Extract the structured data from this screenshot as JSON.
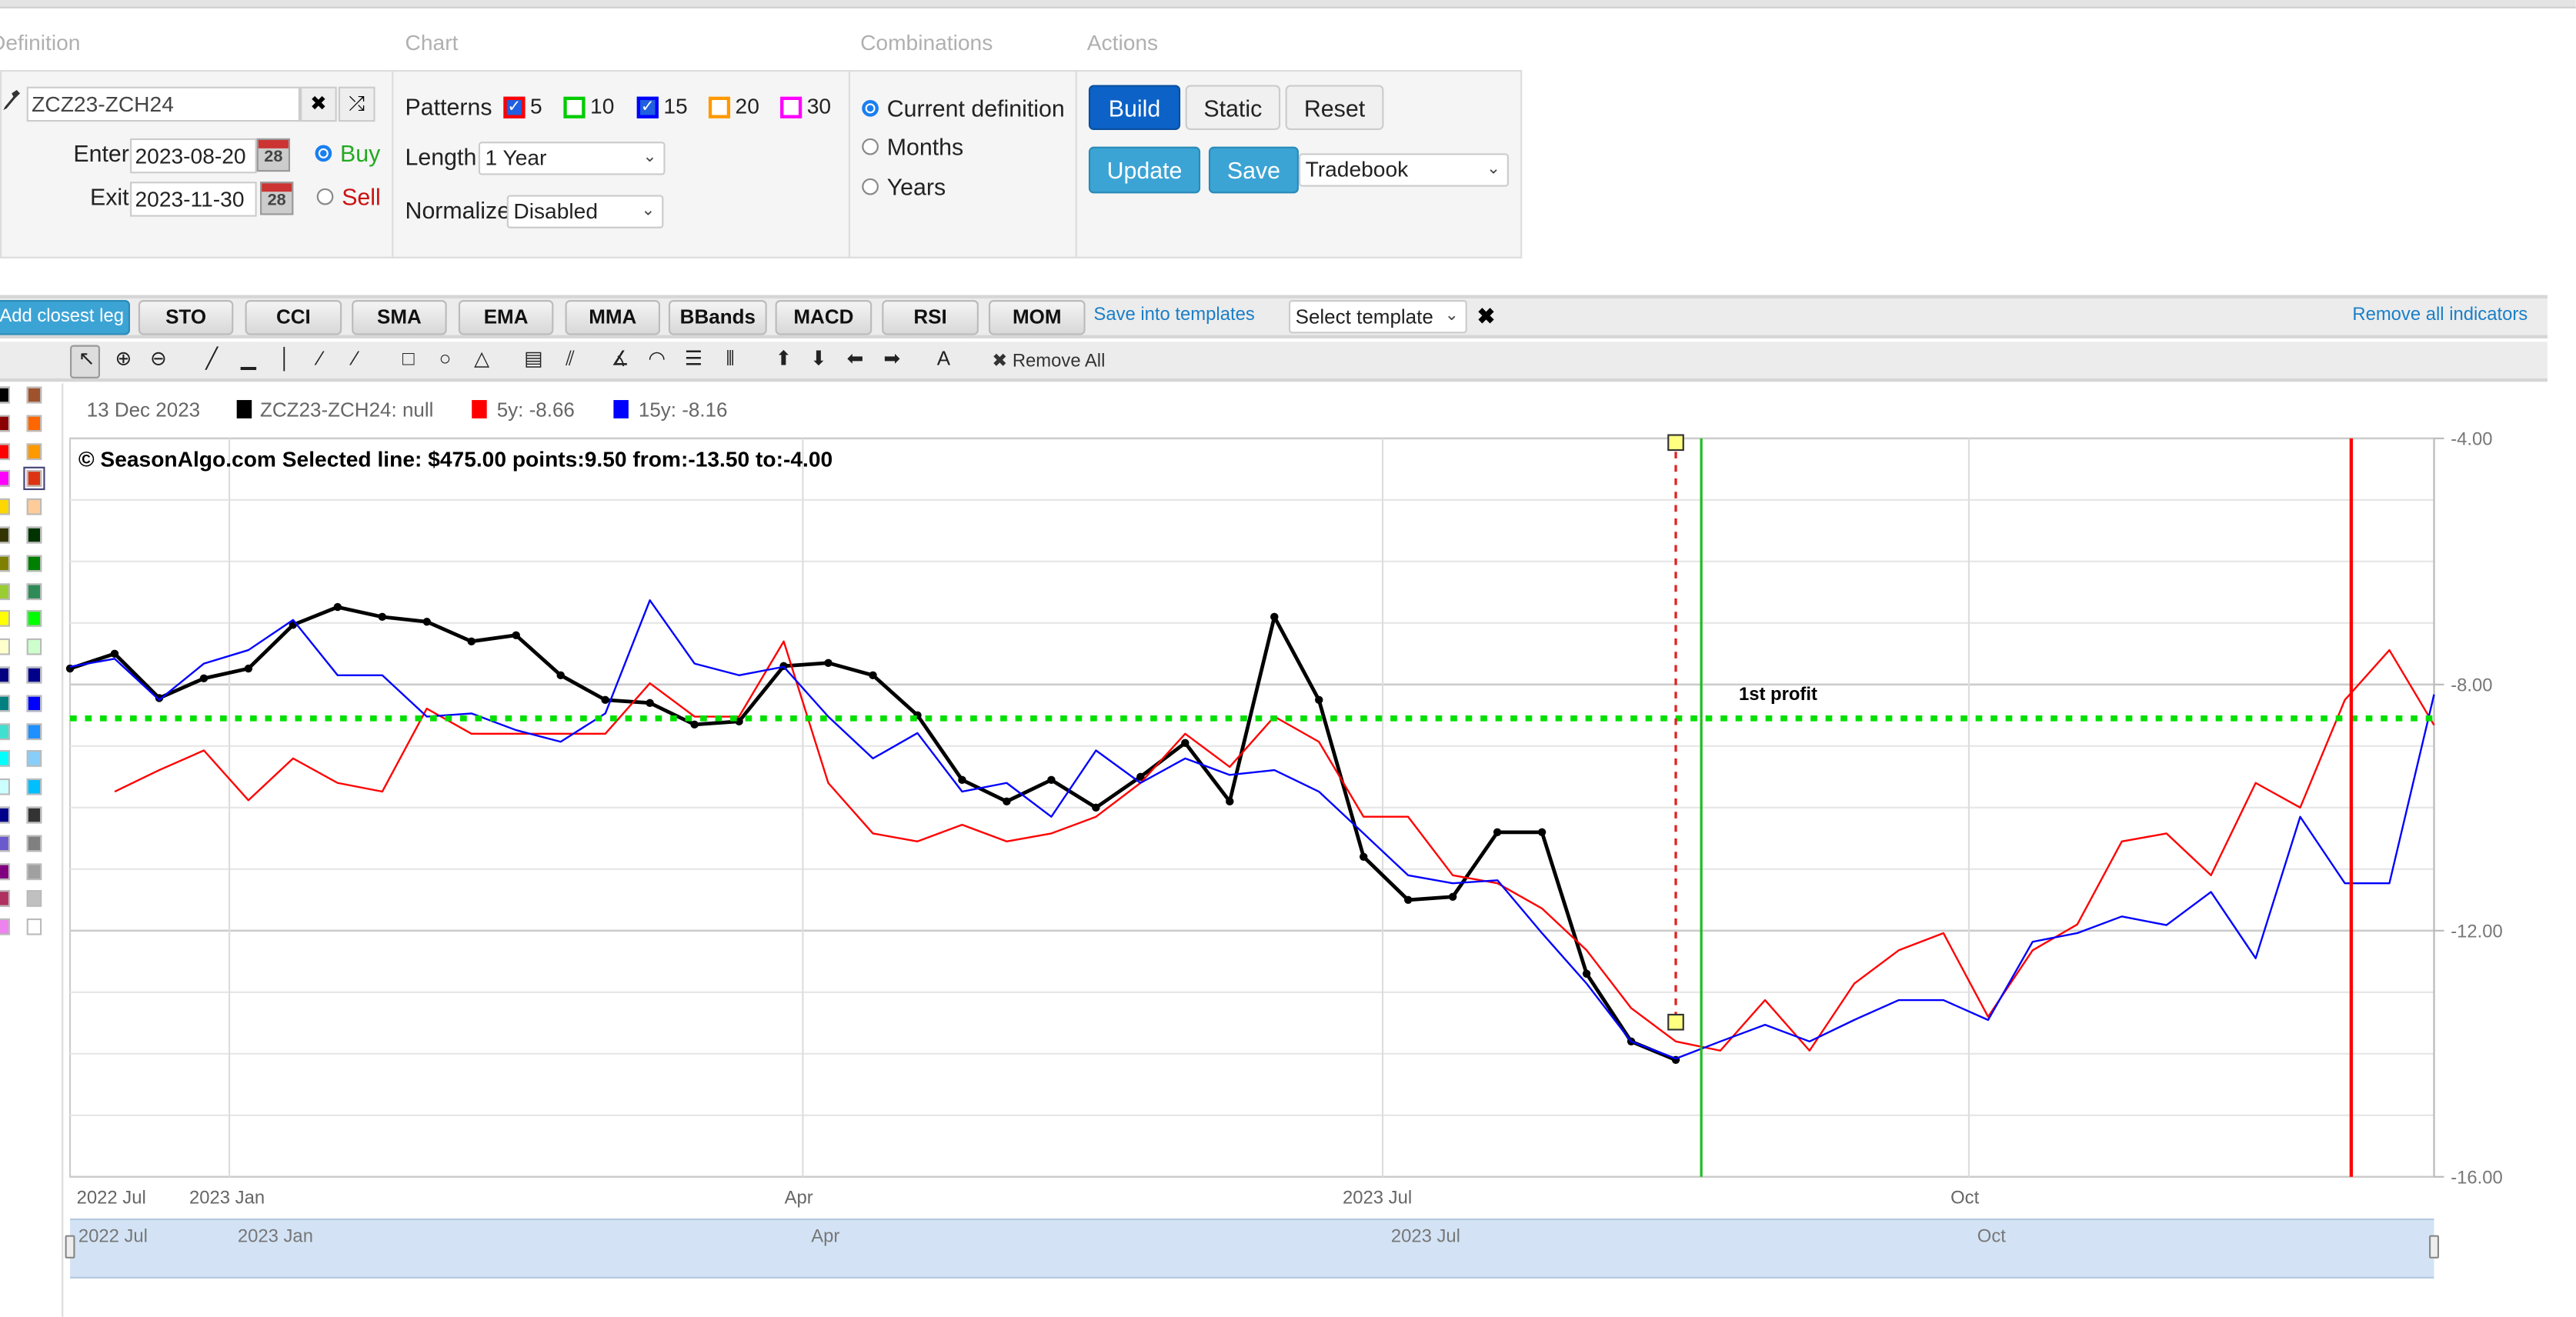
{
  "sections": {
    "definition": "Definition",
    "chart": "Chart",
    "combinations": "Combinations",
    "actions": "Actions"
  },
  "definition": {
    "symbol": "ZCZ23-ZCH24",
    "enter_label": "Enter",
    "enter_date": "2023-08-20",
    "exit_label": "Exit",
    "exit_date": "2023-11-30",
    "calendar_day": "28",
    "buy_label": "Buy",
    "sell_label": "Sell",
    "direction": "Buy",
    "clear_glyph": "✖",
    "shuffle_glyph": "⤮",
    "wrench_glyph": "🔧"
  },
  "chart_settings": {
    "patterns_label": "Patterns",
    "patterns": [
      {
        "label": "5",
        "checked": true,
        "color": "#ff0000"
      },
      {
        "label": "10",
        "checked": false,
        "color": "#00cc00"
      },
      {
        "label": "15",
        "checked": true,
        "color": "#0000ff"
      },
      {
        "label": "20",
        "checked": false,
        "color": "#ff9900"
      },
      {
        "label": "30",
        "checked": false,
        "color": "#ff00ff"
      }
    ],
    "length_label": "Length",
    "length_value": "1 Year",
    "normalize_label": "Normalize",
    "normalize_value": "Disabled"
  },
  "combinations": {
    "options": [
      "Current definition",
      "Months",
      "Years"
    ],
    "selected": "Current definition"
  },
  "actions": {
    "build": "Build",
    "static": "Static",
    "reset": "Reset",
    "update": "Update",
    "save": "Save",
    "tradebook": "Tradebook"
  },
  "indicators": {
    "add_leg": "Add closest leg",
    "buttons": [
      "STO",
      "CCI",
      "SMA",
      "EMA",
      "MMA",
      "BBands",
      "MACD",
      "RSI",
      "MOM"
    ],
    "save_templates": "Save into templates",
    "template_select": "Select template",
    "remove_all_indicators": "Remove all indicators"
  },
  "draw_tools": {
    "icons": [
      "pointer-icon",
      "zoom-in-icon",
      "zoom-out-icon",
      "trend-line-icon",
      "horizontal-line-icon",
      "vertical-line-icon",
      "ray-icon",
      "extended-line-icon",
      "rectangle-icon",
      "circle-icon",
      "triangle-icon",
      "channel-icon",
      "pitchfork-icon",
      "fib-fan-icon",
      "fib-arc-icon",
      "fib-retracement-icon",
      "fib-timezone-icon",
      "arrow-up-icon",
      "arrow-down-icon",
      "arrow-left-icon",
      "arrow-right-icon",
      "text-icon"
    ],
    "glyphs": [
      "↖",
      "⊕",
      "⊖",
      "╱",
      "▁",
      "│",
      "⁄",
      "⁄",
      "□",
      "○",
      "△",
      "▤",
      "⫽",
      "∡",
      "◠",
      "☰",
      "⦀",
      "⬆",
      "⬇",
      "⬅",
      "➡",
      "A"
    ],
    "remove_all": "✖ Remove All"
  },
  "palette": {
    "col1": [
      "#000000",
      "#8b0000",
      "#ff0000",
      "#ff00ff",
      "#ffd700",
      "#333300",
      "#808000",
      "#9acd32",
      "#ffff00",
      "#ffffcc",
      "#000080",
      "#008080",
      "#40e0d0",
      "#00ffff",
      "#ccffff",
      "#00008b",
      "#6a5acd",
      "#800080",
      "#b03060",
      "#ee82ee"
    ],
    "col2": [
      "#a0522d",
      "#ff6600",
      "#ff9900",
      "#dd3311",
      "#ffcc99",
      "#003300",
      "#008000",
      "#2e8b57",
      "#00ff00",
      "#ccffcc",
      "#00008b",
      "#0000ff",
      "#1e90ff",
      "#87cefa",
      "#00bfff",
      "#333333",
      "#808080",
      "#a0a0a0",
      "#c0c0c0",
      "#ffffff"
    ],
    "selected": "#dd3311"
  },
  "legend": {
    "date": "13 Dec 2023",
    "items": [
      {
        "label": "ZCZ23-ZCH24: null",
        "color": "#000000"
      },
      {
        "label": "5y: -8.66",
        "color": "#ff0000"
      },
      {
        "label": "15y: -8.16",
        "color": "#0000ff"
      }
    ]
  },
  "chart_data": {
    "type": "line",
    "title": "© SeasonAlgo.com Selected line: $475.00 points:9.50 from:-13.50 to:-4.00",
    "xlim": [
      "2022-12-07",
      "2023-12-13"
    ],
    "ylim": [
      -16,
      -4
    ],
    "y_ticks": [
      -4,
      -8,
      -12,
      -16
    ],
    "y_tick_labels": [
      "-4.00",
      "-8.00",
      "-12.00",
      "-16.00"
    ],
    "grid": true,
    "x_ticks": [
      {
        "label": "2022 Jul",
        "date": "2022-12-07"
      },
      {
        "label": "2023 Jan",
        "date": "2023-01-01"
      },
      {
        "label": "Apr",
        "date": "2023-04-01"
      },
      {
        "label": "2023 Jul",
        "date": "2023-07-01"
      },
      {
        "label": "Oct",
        "date": "2023-10-01"
      }
    ],
    "x": [
      "2022-12-07",
      "2022-12-14",
      "2022-12-21",
      "2022-12-28",
      "2023-01-04",
      "2023-01-11",
      "2023-01-18",
      "2023-01-25",
      "2023-02-01",
      "2023-02-08",
      "2023-02-15",
      "2023-02-22",
      "2023-03-01",
      "2023-03-08",
      "2023-03-15",
      "2023-03-22",
      "2023-03-29",
      "2023-04-05",
      "2023-04-12",
      "2023-04-19",
      "2023-04-26",
      "2023-05-03",
      "2023-05-10",
      "2023-05-17",
      "2023-05-24",
      "2023-05-31",
      "2023-06-07",
      "2023-06-14",
      "2023-06-21",
      "2023-06-28",
      "2023-07-05",
      "2023-07-12",
      "2023-07-19",
      "2023-07-26",
      "2023-08-02",
      "2023-08-09",
      "2023-08-16",
      "2023-08-23",
      "2023-08-30",
      "2023-09-06",
      "2023-09-13",
      "2023-09-20",
      "2023-09-27",
      "2023-10-04",
      "2023-10-11",
      "2023-10-18",
      "2023-10-25",
      "2023-11-01",
      "2023-11-08",
      "2023-11-15",
      "2023-11-22",
      "2023-11-29",
      "2023-12-06",
      "2023-12-13"
    ],
    "series": [
      {
        "name": "ZCZ23-ZCH24",
        "color": "#000000",
        "markers": true,
        "values": [
          -7.74,
          -7.5,
          -8.22,
          -7.9,
          -7.74,
          -7.03,
          -6.74,
          -6.9,
          -6.98,
          -7.3,
          -7.2,
          -7.85,
          -8.25,
          -8.3,
          -8.65,
          -8.6,
          -7.7,
          -7.65,
          -7.85,
          -8.5,
          -9.55,
          -9.9,
          -9.55,
          -10.0,
          -9.5,
          -8.95,
          -9.9,
          -6.9,
          -8.25,
          -10.8,
          -11.5,
          -11.45,
          -10.4,
          -10.4,
          -12.7,
          -13.8,
          -14.1,
          null,
          null,
          null,
          null,
          null,
          null,
          null,
          null,
          null,
          null,
          null,
          null,
          null,
          null,
          null,
          null,
          null
        ]
      },
      {
        "name": "5y",
        "color": "#ff0000",
        "markers": false,
        "values": [
          null,
          -9.74,
          -9.39,
          -9.07,
          -9.88,
          -9.2,
          -9.6,
          -9.74,
          -8.39,
          -8.8,
          -8.8,
          -8.8,
          -8.8,
          -7.98,
          -8.52,
          -8.52,
          -7.3,
          -9.6,
          -10.42,
          -10.55,
          -10.28,
          -10.55,
          -10.42,
          -10.15,
          -9.6,
          -8.8,
          -9.34,
          -8.52,
          -8.93,
          -10.15,
          -10.15,
          -11.1,
          -11.23,
          -11.64,
          -12.32,
          -13.26,
          -13.8,
          -13.95,
          -13.13,
          -13.95,
          -12.86,
          -12.32,
          -12.04,
          -13.4,
          -12.32,
          -11.9,
          -10.55,
          -10.42,
          -11.1,
          -9.6,
          -10.0,
          -8.25,
          -7.44,
          -8.66
        ]
      },
      {
        "name": "15y",
        "color": "#0000ff",
        "markers": false,
        "values": [
          -7.71,
          -7.58,
          -8.25,
          -7.66,
          -7.44,
          -6.95,
          -7.85,
          -7.85,
          -8.52,
          -8.47,
          -8.74,
          -8.93,
          -8.47,
          -6.63,
          -7.66,
          -7.85,
          -7.71,
          -8.52,
          -9.2,
          -8.79,
          -9.74,
          -9.6,
          -10.15,
          -9.07,
          -9.6,
          -9.2,
          -9.47,
          -9.39,
          -9.74,
          -10.42,
          -11.1,
          -11.23,
          -11.18,
          -12.04,
          -12.86,
          -13.8,
          -14.08,
          -13.8,
          -13.53,
          -13.8,
          -13.45,
          -13.13,
          -13.13,
          -13.45,
          -12.18,
          -12.04,
          -11.77,
          -11.91,
          -11.37,
          -12.45,
          -10.15,
          -11.23,
          -11.23,
          -8.16
        ]
      }
    ],
    "annotations": {
      "profit_line": {
        "label": "1st profit",
        "value": -8.55,
        "color": "#00e000"
      },
      "entry_line": {
        "date": "2023-08-20",
        "color": "#22bb22"
      },
      "exit_line": {
        "date": "2023-11-30",
        "color": "#ff0000"
      },
      "selected_line": {
        "date": "2023-08-16",
        "from": -13.5,
        "to": -4.0,
        "color": "#dd2222"
      }
    },
    "navigator_labels": [
      {
        "label": "2022 Jul",
        "date": "2022-12-07"
      },
      {
        "label": "2023 Jan",
        "date": "2023-01-01"
      },
      {
        "label": "Apr",
        "date": "2023-04-01"
      },
      {
        "label": "2023 Jul",
        "date": "2023-07-01"
      },
      {
        "label": "Oct",
        "date": "2023-10-01"
      }
    ]
  }
}
